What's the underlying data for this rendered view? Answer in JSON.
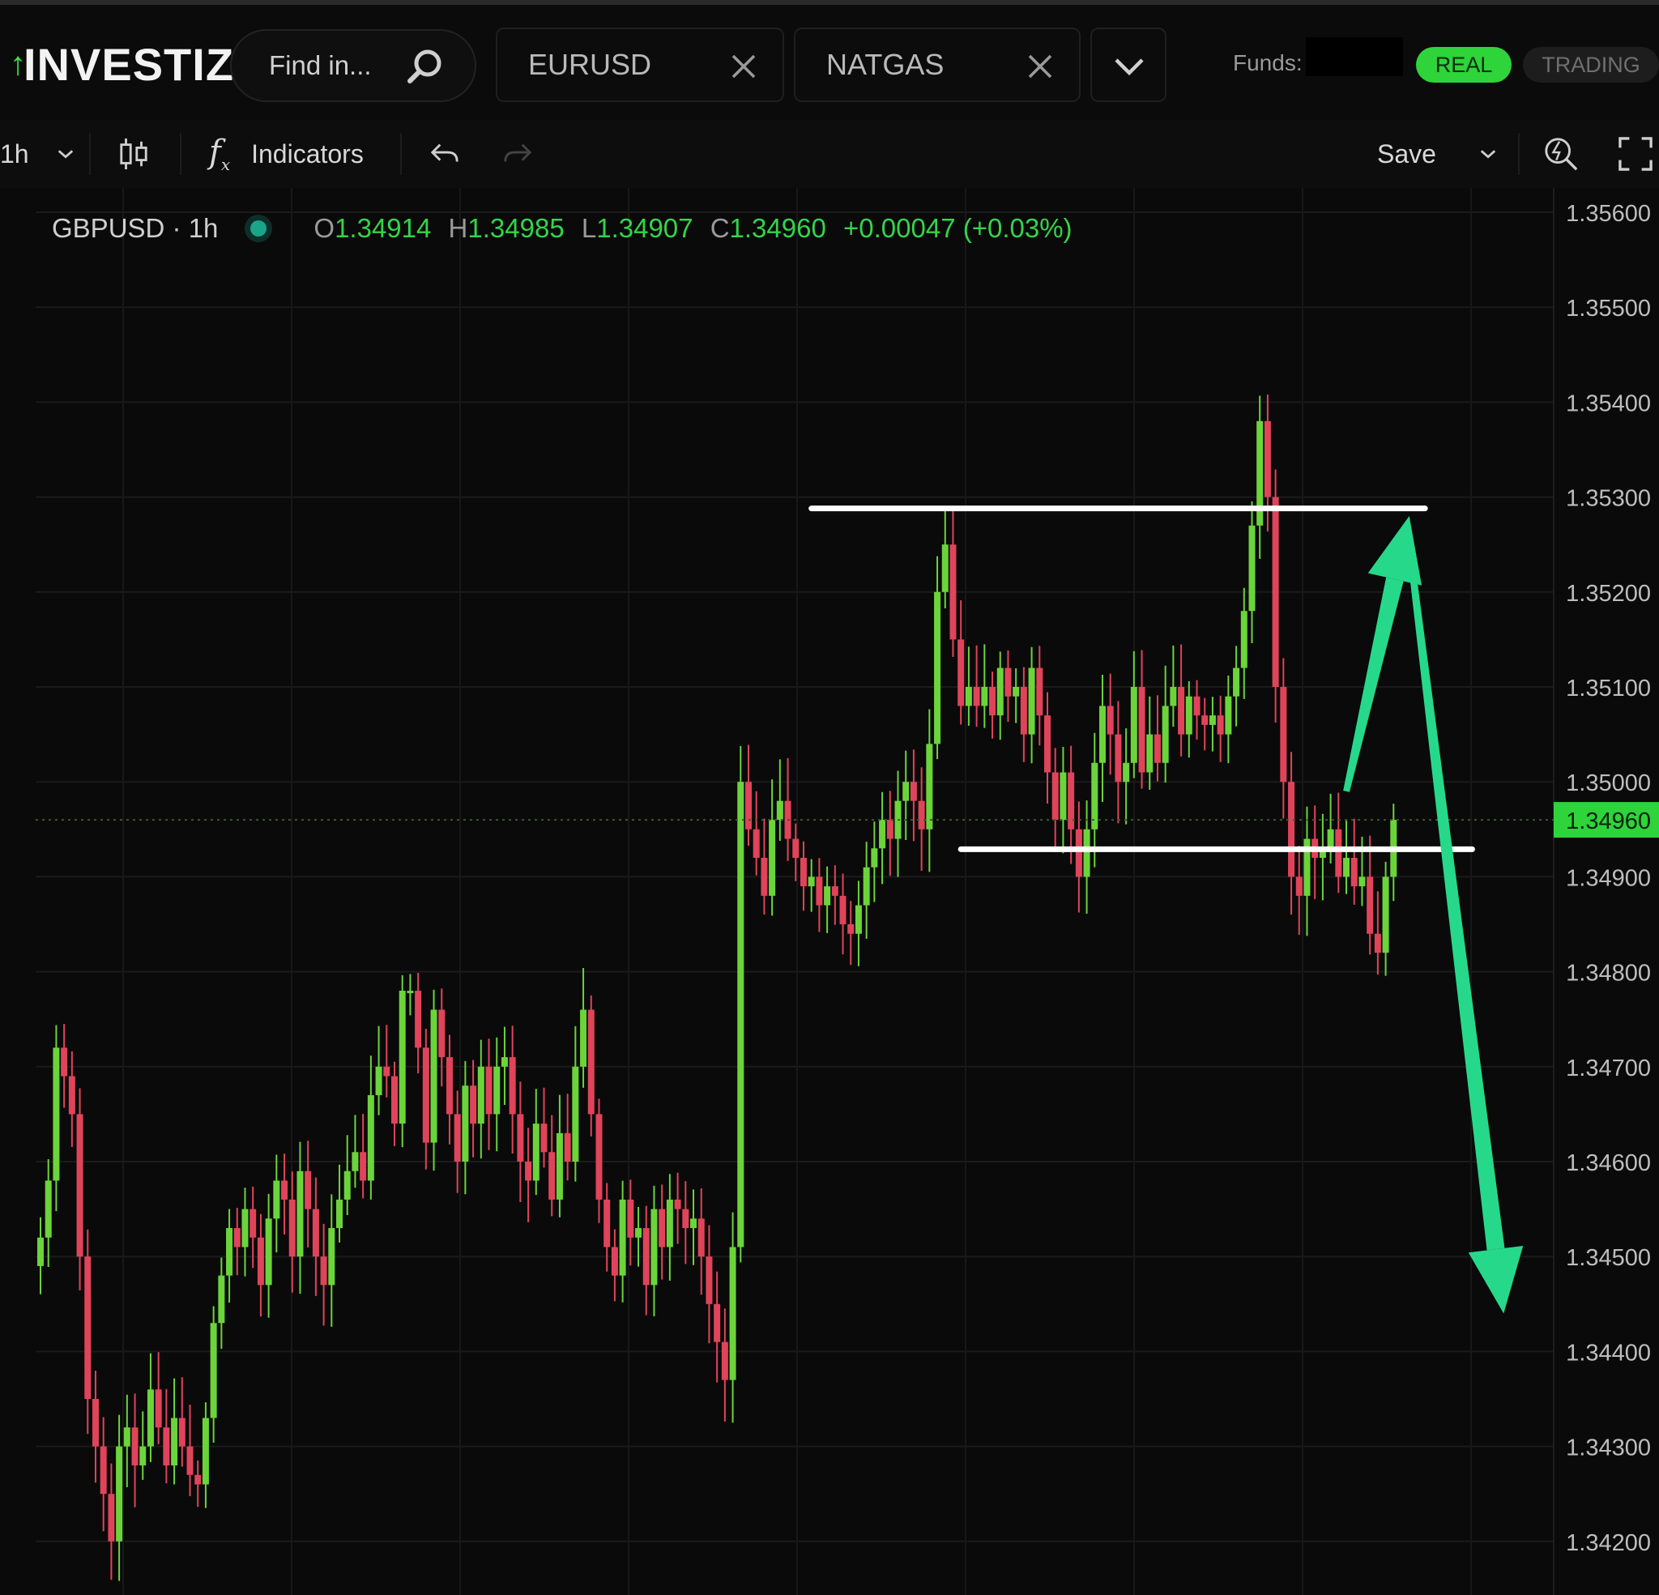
{
  "header": {
    "logo_text": "INVESTIZO",
    "search_placeholder": "Find in...",
    "tabs": [
      {
        "label": "EURUSD"
      },
      {
        "label": "NATGAS"
      }
    ],
    "funds_label": "Funds:",
    "mode_real": "REAL",
    "mode_trading": "TRADING"
  },
  "toolbar": {
    "interval": "1h",
    "indicators_label": "Indicators",
    "save_label": "Save"
  },
  "legend": {
    "symbol": "GBPUSD · 1h",
    "o_key": "O",
    "o_val": "1.34914",
    "h_key": "H",
    "h_val": "1.34985",
    "l_key": "L",
    "l_val": "1.34907",
    "c_key": "C",
    "c_val": "1.34960",
    "change": "+0.00047 (+0.03%)"
  },
  "colors": {
    "up": "#6bd43a",
    "down": "#e0445a",
    "price_tag": "#2ed43a",
    "annotation_arrow": "#26d98a",
    "annotation_line": "#ffffff"
  },
  "chart_data": {
    "type": "candlestick",
    "symbol": "GBPUSD",
    "interval": "1h",
    "ylim": [
      1.3415,
      1.3565
    ],
    "y_ticks": [
      "1.35600",
      "1.35500",
      "1.35400",
      "1.35300",
      "1.35200",
      "1.35100",
      "1.35000",
      "1.34900",
      "1.34800",
      "1.34700",
      "1.34600",
      "1.34500",
      "1.34400",
      "1.34300",
      "1.34200"
    ],
    "last_price": "1.34960",
    "close_series": [
      1.3452,
      1.3458,
      1.3472,
      1.3469,
      1.3465,
      1.345,
      1.3435,
      1.343,
      1.3425,
      1.342,
      1.343,
      1.3432,
      1.3428,
      1.343,
      1.3436,
      1.3432,
      1.3428,
      1.3433,
      1.343,
      1.3427,
      1.3426,
      1.3433,
      1.3443,
      1.3448,
      1.3453,
      1.3451,
      1.3455,
      1.3452,
      1.3447,
      1.3454,
      1.3458,
      1.3456,
      1.345,
      1.3459,
      1.3455,
      1.345,
      1.3447,
      1.3453,
      1.3456,
      1.3459,
      1.3461,
      1.3458,
      1.3467,
      1.347,
      1.3469,
      1.3464,
      1.3478,
      1.3478,
      1.3472,
      1.3462,
      1.3476,
      1.3471,
      1.3465,
      1.346,
      1.3468,
      1.3464,
      1.347,
      1.3465,
      1.347,
      1.3471,
      1.3465,
      1.346,
      1.3458,
      1.3464,
      1.3461,
      1.3456,
      1.3463,
      1.346,
      1.347,
      1.3476,
      1.3465,
      1.3456,
      1.3451,
      1.3448,
      1.3456,
      1.3452,
      1.3453,
      1.3447,
      1.3455,
      1.3451,
      1.3456,
      1.3455,
      1.3453,
      1.3454,
      1.345,
      1.3445,
      1.3441,
      1.3437,
      1.3451,
      1.35,
      1.3495,
      1.3492,
      1.3488,
      1.3496,
      1.3498,
      1.3494,
      1.3492,
      1.3489,
      1.349,
      1.3487,
      1.3489,
      1.3488,
      1.3485,
      1.3484,
      1.3487,
      1.3491,
      1.3493,
      1.3496,
      1.3494,
      1.3498,
      1.35,
      1.3498,
      1.3495,
      1.3504,
      1.352,
      1.3525,
      1.3515,
      1.3508,
      1.351,
      1.3508,
      1.351,
      1.3507,
      1.3512,
      1.3509,
      1.351,
      1.3505,
      1.3512,
      1.3507,
      1.3501,
      1.3496,
      1.3501,
      1.3495,
      1.349,
      1.3495,
      1.3502,
      1.3508,
      1.3505,
      1.35,
      1.3502,
      1.351,
      1.3501,
      1.3505,
      1.3502,
      1.3508,
      1.351,
      1.3505,
      1.3509,
      1.3507,
      1.3506,
      1.3507,
      1.3505,
      1.3509,
      1.3512,
      1.3518,
      1.3527,
      1.3538,
      1.353,
      1.351,
      1.35,
      1.349,
      1.3488,
      1.3494,
      1.3492,
      1.3493,
      1.3495,
      1.349,
      1.3492,
      1.3489,
      1.349,
      1.3484,
      1.3482,
      1.349,
      1.3496
    ],
    "annotations": [
      {
        "type": "horizontal_line",
        "price": 1.35288,
        "x_from_bar": 98,
        "x_to_bar": 176
      },
      {
        "type": "horizontal_line",
        "price": 1.34929,
        "x_from_bar": 117,
        "x_to_bar": 182
      },
      {
        "type": "arrow",
        "from": {
          "bar": 166,
          "price": 1.3499
        },
        "to": {
          "bar": 174,
          "price": 1.3528
        }
      },
      {
        "type": "arrow",
        "from": {
          "bar": 174,
          "price": 1.3525
        },
        "to": {
          "bar": 186,
          "price": 1.3444
        }
      }
    ]
  }
}
